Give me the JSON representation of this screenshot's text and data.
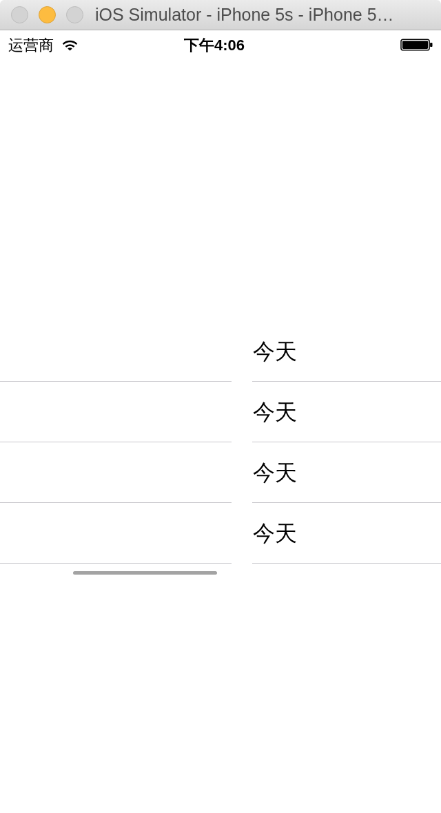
{
  "window": {
    "title": "iOS Simulator - iPhone 5s - iPhone 5…",
    "controls": [
      {
        "kind": "close",
        "active": false
      },
      {
        "kind": "minimize",
        "active": true
      },
      {
        "kind": "zoom",
        "active": false
      }
    ]
  },
  "status_bar": {
    "carrier": "运营商",
    "time": "下午4:06"
  },
  "table": {
    "rows": [
      {
        "label": "今天"
      },
      {
        "label": "今天"
      },
      {
        "label": "今天"
      },
      {
        "label": "今天"
      }
    ]
  }
}
